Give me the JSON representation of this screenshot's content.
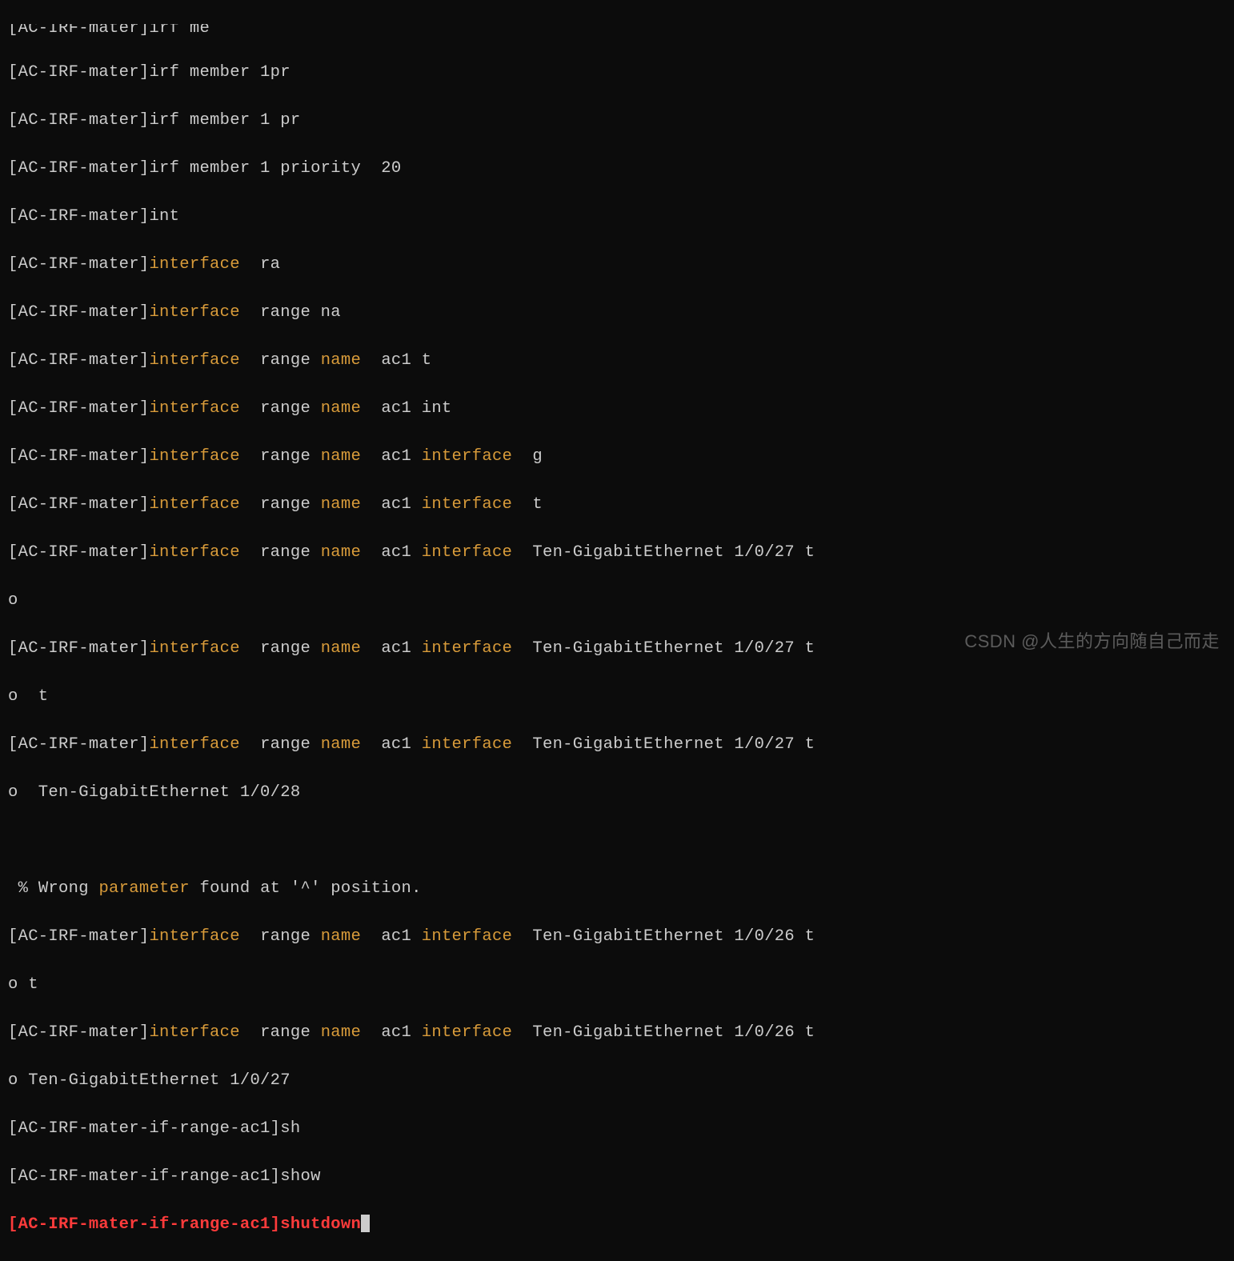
{
  "prompt": "[AC-IRF-mater]",
  "prompt_range": "[AC-IRF-mater-if-range-ac1]",
  "kw": {
    "interface": "interface",
    "name": "name",
    "parameter": "parameter"
  },
  "lines": {
    "l0a": "[AC-IRF-mater]irf me",
    "l1": "irf member 1pr",
    "l2": "irf member 1 pr",
    "l3": "irf member 1 priority  20",
    "l4": "int",
    "l5_tail": "  ra",
    "l6_tail": "  range na",
    "l7_range": "  range ",
    "l7_tail": "  ac1 t",
    "l8_tail": "  ac1 int",
    "l9_tail": "  ac1 ",
    "l9_g": "  g",
    "l10_t": "  t",
    "l11_tail": "  Ten-GigabitEthernet 1/0/27 t",
    "l11_cont": "o",
    "l12_cont": "o  t",
    "l13_cont": "o  Ten-GigabitEthernet 1/0/28",
    "err_a": " % Wrong ",
    "err_b": " found at '^' position.",
    "l14_tail": "  Ten-GigabitEthernet 1/0/26 t",
    "l14_cont": "o t",
    "l15_cont": "o Ten-GigabitEthernet 1/0/27",
    "l16": "sh",
    "l17": "show",
    "l18": "shutdown"
  },
  "watermark": "CSDN @人生的方向随自己而走"
}
